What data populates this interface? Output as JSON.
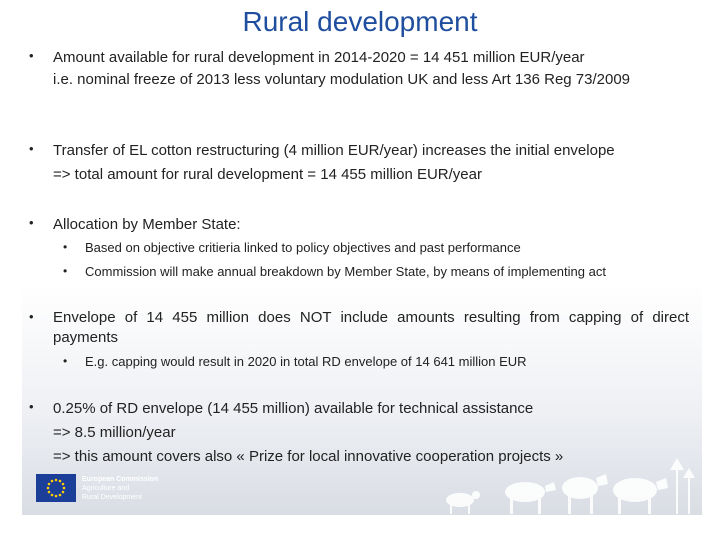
{
  "title": "Rural development",
  "bullets": [
    {
      "lines": [
        "Amount available for rural development in 2014-2020 = 14 451 million EUR/year",
        "i.e. nominal freeze of 2013 less voluntary modulation UK and less Art 136 Reg 73/2009"
      ]
    },
    {
      "lines": [
        "Transfer of EL cotton restructuring (4 million EUR/year) increases the initial envelope",
        "=> total amount for rural development = 14 455 million EUR/year"
      ]
    },
    {
      "lines": [
        "Allocation by Member State:"
      ],
      "subs": [
        "Based on objective critieria linked to policy objectives and past performance",
        "Commission will make annual breakdown by Member State, by means of implementing act"
      ]
    },
    {
      "lines": [
        "Envelope of 14 455 million does NOT include amounts resulting from capping of direct payments"
      ],
      "subs": [
        "E.g. capping would result in 2020 in total RD envelope of 14 641 million EUR"
      ]
    },
    {
      "lines": [
        "0.25% of RD envelope (14 455 million) available for technical assistance",
        "=> 8.5 million/year",
        "=> this amount covers also « Prize for local innovative cooperation projects »"
      ]
    }
  ],
  "footer": {
    "line1": "European Commission",
    "line2": "Agriculture and",
    "line3": "Rural Development"
  },
  "colors": {
    "title": "#1f4e9e",
    "eu_blue": "#1b3f99",
    "eu_star": "#ffcc00"
  }
}
